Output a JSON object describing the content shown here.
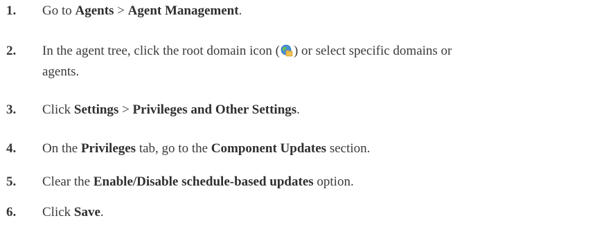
{
  "steps": [
    {
      "number": "1.",
      "parts": [
        "Go to ",
        "Agents",
        " > ",
        "Agent Management",
        "."
      ]
    },
    {
      "number": "2.",
      "parts_before_icon": "In the agent tree, click the root domain icon (",
      "icon": "globe-folder-icon",
      "parts_after_icon": ") or select specific domains or",
      "line2": "agents."
    },
    {
      "number": "3.",
      "parts": [
        "Click ",
        "Settings",
        " > ",
        "Privileges and Other Settings",
        "."
      ]
    },
    {
      "number": "4.",
      "parts": [
        "On the ",
        "Privileges",
        " tab, go to the ",
        "Component Updates",
        " section."
      ]
    },
    {
      "number": "5.",
      "parts": [
        "Clear the ",
        "Enable/Disable schedule-based updates",
        " option."
      ]
    },
    {
      "number": "6.",
      "parts": [
        "Click ",
        "Save",
        "."
      ]
    }
  ]
}
